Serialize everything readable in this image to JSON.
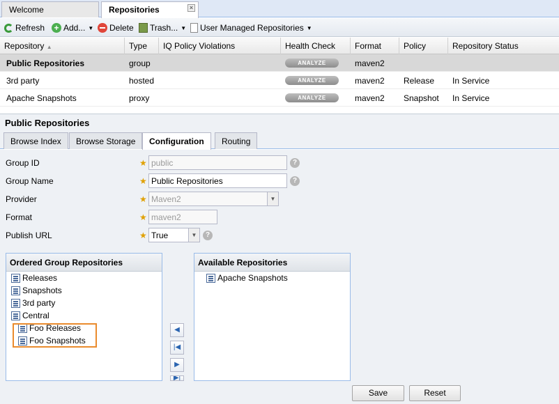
{
  "tabs": [
    {
      "label": "Welcome",
      "active": false
    },
    {
      "label": "Repositories",
      "active": true,
      "close": "×"
    }
  ],
  "toolbar": {
    "refresh": "Refresh",
    "add": "Add...",
    "delete": "Delete",
    "trash": "Trash...",
    "user_managed": "User Managed Repositories"
  },
  "grid": {
    "columns": [
      "Repository",
      "Type",
      "IQ Policy Violations",
      "Health Check",
      "Format",
      "Policy",
      "Repository Status"
    ],
    "sort_indicator": "▲",
    "analyze_label": "ANALYZE",
    "rows": [
      {
        "repository": "Public Repositories",
        "type": "group",
        "iq": "",
        "format": "maven2",
        "policy": "",
        "status": ""
      },
      {
        "repository": "3rd party",
        "type": "hosted",
        "iq": "",
        "format": "maven2",
        "policy": "Release",
        "status": "In Service"
      },
      {
        "repository": "Apache Snapshots",
        "type": "proxy",
        "iq": "",
        "format": "maven2",
        "policy": "Snapshot",
        "status": "In Service"
      }
    ]
  },
  "detail": {
    "title": "Public Repositories",
    "subtabs": [
      "Browse Index",
      "Browse Storage",
      "Configuration",
      "Routing"
    ],
    "active_subtab": "Configuration",
    "form": {
      "group_id_label": "Group ID",
      "group_id_value": "public",
      "group_name_label": "Group Name",
      "group_name_value": "Public Repositories",
      "provider_label": "Provider",
      "provider_value": "Maven2",
      "format_label": "Format",
      "format_value": "maven2",
      "publish_url_label": "Publish URL",
      "publish_url_value": "True",
      "required_marker": "★",
      "help_glyph": "?"
    },
    "ordered": {
      "title": "Ordered Group Repositories",
      "items": [
        "Releases",
        "Snapshots",
        "3rd party",
        "Central",
        "Foo Releases",
        "Foo Snapshots"
      ]
    },
    "available": {
      "title": "Available Repositories",
      "items": [
        "Apache Snapshots"
      ]
    },
    "move_buttons": [
      "◀",
      "|◀",
      "▶",
      "▶|"
    ],
    "save": "Save",
    "reset": "Reset"
  },
  "colors": {
    "highlight": "#ea8b2d",
    "selected_row": "#d8d8d8",
    "panel_bg": "#eef1f5",
    "required_star": "#e0a000"
  }
}
